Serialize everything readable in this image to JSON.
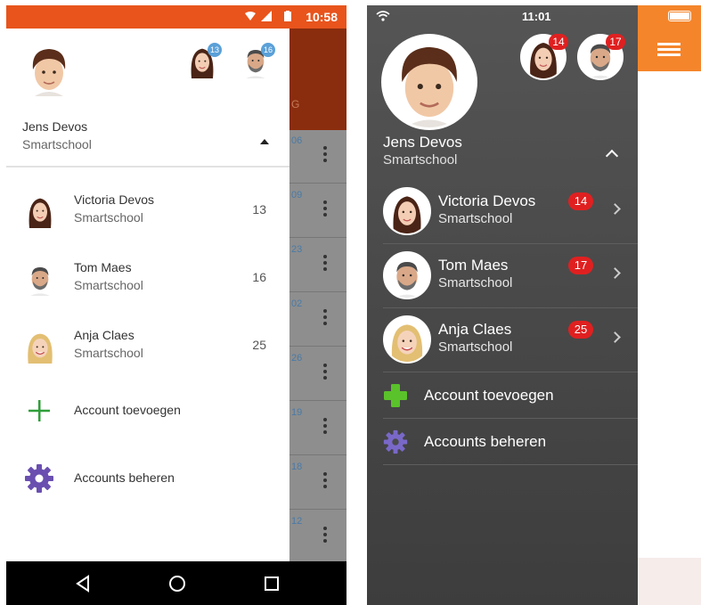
{
  "android": {
    "status_time": "10:58",
    "header": {
      "name": "Jens Devos",
      "subtitle": "Smartschool"
    },
    "mini_avatars": [
      {
        "badge": "13"
      },
      {
        "badge": "16"
      }
    ],
    "background_app": {
      "tab_letter": "G",
      "row_numbers": [
        "06",
        "09",
        "23",
        "02",
        "26",
        "19",
        "18",
        "12"
      ]
    },
    "accounts": [
      {
        "name": "Victoria Devos",
        "subtitle": "Smartschool",
        "count": "13"
      },
      {
        "name": "Tom Maes",
        "subtitle": "Smartschool",
        "count": "16"
      },
      {
        "name": "Anja Claes",
        "subtitle": "Smartschool",
        "count": "25"
      }
    ],
    "actions": {
      "add_account": "Account toevoegen",
      "manage_accounts": "Accounts beheren"
    },
    "colors": {
      "status_bar": "#e8541c",
      "add_icon": "#2e9e3a",
      "gear_icon": "#6a4fb0",
      "badge": "#5aa0d8"
    }
  },
  "ios": {
    "status_time": "11:01",
    "header": {
      "name": "Jens Devos",
      "subtitle": "Smartschool"
    },
    "mini_avatars": [
      {
        "badge": "14"
      },
      {
        "badge": "17"
      }
    ],
    "accounts": [
      {
        "name": "Victoria Devos",
        "subtitle": "Smartschool",
        "badge": "14"
      },
      {
        "name": "Tom Maes",
        "subtitle": "Smartschool",
        "badge": "17"
      },
      {
        "name": "Anja Claes",
        "subtitle": "Smartschool",
        "badge": "25"
      }
    ],
    "actions": {
      "add_account": "Account toevoegen",
      "manage_accounts": "Accounts beheren"
    },
    "colors": {
      "app_header": "#f5852b",
      "badge": "#e02020",
      "add_icon": "#5ac22a",
      "gear_icon": "#7a68c8"
    }
  }
}
